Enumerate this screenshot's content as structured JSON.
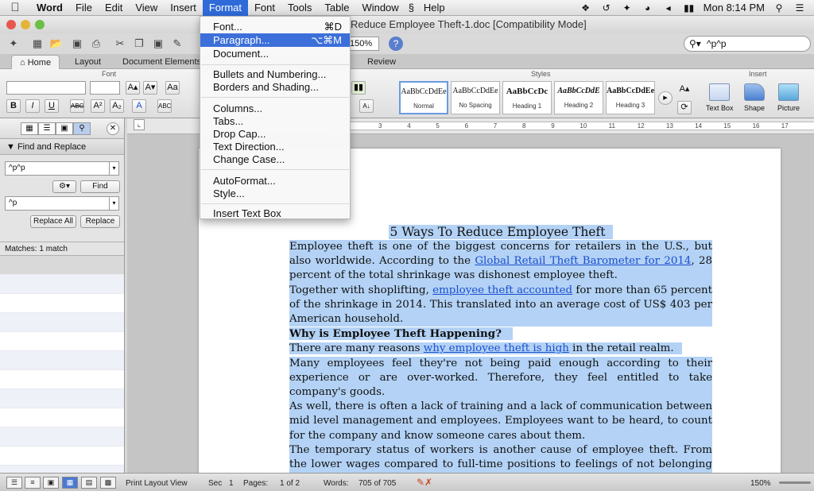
{
  "menubar": {
    "app": "Word",
    "items": [
      "File",
      "Edit",
      "View",
      "Insert",
      "Format",
      "Font",
      "Tools",
      "Table",
      "Window",
      "Help"
    ],
    "active": "Format",
    "clock": "Mon 8:14 PM"
  },
  "window": {
    "title": "Reduce Employee Theft-1.doc [Compatibility Mode]",
    "zoom": "150%",
    "search_value": "^p^p"
  },
  "ribbon": {
    "tabs": [
      "Home",
      "Layout",
      "Document Elements",
      "Review"
    ],
    "active_tab": "Home",
    "groups": {
      "font": "Font",
      "styles": "Styles",
      "insert": "Insert"
    },
    "styles": [
      {
        "sample": "AaBbCcDdEe",
        "name": "Normal"
      },
      {
        "sample": "AaBbCcDdEe",
        "name": "No Spacing"
      },
      {
        "sample": "AaBbCcDc",
        "name": "Heading 1"
      },
      {
        "sample": "AaBbCcDdE",
        "name": "Heading 2"
      },
      {
        "sample": "AaBbCcDdEe",
        "name": "Heading 3"
      }
    ],
    "insert_items": [
      "Text Box",
      "Shape",
      "Picture"
    ]
  },
  "format_menu": {
    "items": [
      {
        "label": "Font...",
        "shortcut": "⌘D"
      },
      {
        "label": "Paragraph...",
        "shortcut": "⌥⌘M",
        "highlighted": true
      },
      {
        "label": "Document...",
        "shortcut": ""
      },
      {
        "label": "Bullets and Numbering...",
        "shortcut": ""
      },
      {
        "label": "Borders and Shading...",
        "shortcut": ""
      },
      {
        "label": "Columns...",
        "shortcut": ""
      },
      {
        "label": "Tabs...",
        "shortcut": ""
      },
      {
        "label": "Drop Cap...",
        "shortcut": ""
      },
      {
        "label": "Text Direction...",
        "shortcut": ""
      },
      {
        "label": "Change Case...",
        "shortcut": ""
      },
      {
        "label": "AutoFormat...",
        "shortcut": ""
      },
      {
        "label": "Style...",
        "shortcut": ""
      },
      {
        "label": "Insert Text Box",
        "shortcut": ""
      }
    ]
  },
  "sidebar": {
    "section_title": "Find and Replace",
    "find_value": "^p^p",
    "find_button": "Find",
    "replace_value": "^p",
    "replace_all_button": "Replace All",
    "replace_button": "Replace",
    "matches": "Matches: 1 match"
  },
  "ruler_numbers": [
    "3",
    "4",
    "5",
    "6",
    "7",
    "8",
    "9",
    "10",
    "11",
    "12",
    "13",
    "14",
    "15",
    "16",
    "17"
  ],
  "document": {
    "title": "5 Ways To Reduce Employee Theft",
    "p1_a": "Employee theft is one of the biggest concerns for retailers in the U.S., but also worldwide. According to the ",
    "p1_link": "Global Retail Theft Barometer for 2014",
    "p1_b": ", 28 percent of the total shrinkage was dishonest employee theft.",
    "p2_a": "Together with shoplifting, ",
    "p2_link": "employee theft accounted",
    "p2_b": " for more than 65 percent of the shrinkage in 2014. This translated into an average cost of US$ 403 per American household.",
    "h2": "Why is Employee Theft Happening?",
    "p3_a": "There are many reasons ",
    "p3_link": "why employee theft is high",
    "p3_b": " in the retail realm.",
    "p4": "Many employees feel they're not being paid enough according to their experience or are over-worked. Therefore, they feel entitled to take company's goods.",
    "p5": " As well, there is often a lack of training and a lack of communication between mid level management and employees. Employees want to be heard, to count for the company and know someone cares about them.",
    "p6": "The temporary status of workers is another cause of employee theft. From the lower wages compared to full-time positions to feelings of not belonging to the"
  },
  "statusbar": {
    "view": "Print Layout View",
    "sec_label": "Sec",
    "sec": "1",
    "pages_label": "Pages:",
    "pages": "1 of 2",
    "words_label": "Words:",
    "words": "705 of 705",
    "zoom": "150%"
  },
  "colors": {
    "selection": "#b3d2f5",
    "menu_highlight": "#3c6fd9",
    "link": "#1a4fd0"
  }
}
